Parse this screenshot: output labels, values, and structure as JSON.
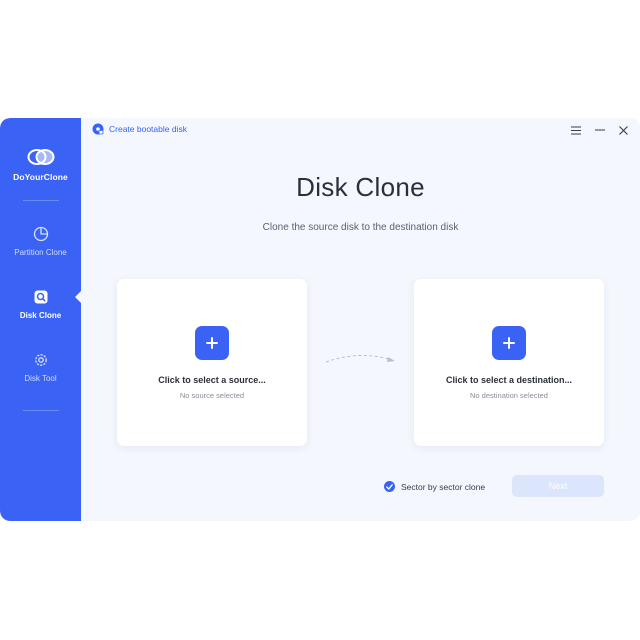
{
  "app": {
    "name": "DoYourClone"
  },
  "sidebar": {
    "items": [
      {
        "label": "Partition Clone",
        "icon": "pie-chart-icon",
        "active": false
      },
      {
        "label": "Disk Clone",
        "icon": "disk-search-icon",
        "active": true
      },
      {
        "label": "Disk Tool",
        "icon": "gear-icon",
        "active": false
      }
    ]
  },
  "titlebar": {
    "bootable_label": "Create bootable disk",
    "menu_icon": "menu-icon",
    "minimize_icon": "minimize-icon",
    "close_icon": "close-icon"
  },
  "main": {
    "title": "Disk Clone",
    "subtitle": "Clone the source disk to the destination disk",
    "source_card": {
      "title": "Click to select a source...",
      "status": "No source selected"
    },
    "destination_card": {
      "title": "Click to select a destination...",
      "status": "No destination selected"
    },
    "sector_clone": {
      "label": "Sector by sector clone",
      "checked": true
    },
    "next_label": "Next"
  },
  "colors": {
    "accent": "#3a63f5",
    "background": "#f4f7fd",
    "disabled_button": "#dbe5fb"
  }
}
